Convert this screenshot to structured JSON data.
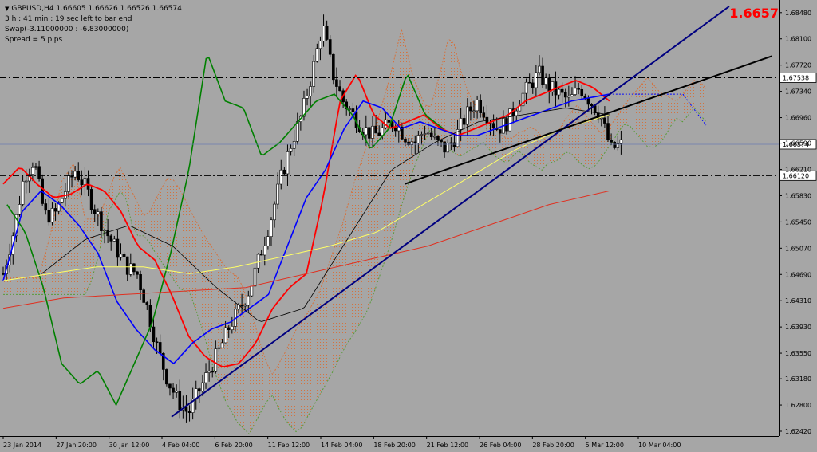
{
  "header": {
    "symbol_line": "GBPUSD,H4  1.66605 1.66626 1.66526 1.66574",
    "timer_line": "3 h : 41 min : 19 sec left to bar end",
    "swap_line": "Swap(-3.11000000 : -6.83000000)",
    "spread_line": "Spread = 5 pips",
    "current_price_big": "1.6657"
  },
  "colors": {
    "background": "#a6a6a6",
    "kijun": "#0000ff",
    "tenkan": "#ff0000",
    "chikou": "#008000",
    "ma_yellow": "#ffff66",
    "ma_red": "#e03020",
    "ma_black": "#000000",
    "trendline": "#000080",
    "cloud_up": "#d4733f",
    "cloud_down": "#5a9a3a"
  },
  "chart_data": {
    "type": "candlestick",
    "symbol": "GBPUSD",
    "timeframe": "H4",
    "ylim": [
      1.6242,
      1.6857
    ],
    "y_ticks": [
      "1.68480",
      "1.68100",
      "1.67720",
      "1.67340",
      "1.66960",
      "1.66590",
      "1.66210",
      "1.65830",
      "1.65450",
      "1.65070",
      "1.64690",
      "1.64310",
      "1.63930",
      "1.63550",
      "1.63180",
      "1.62800",
      "1.62420"
    ],
    "x_ticks": [
      "23 Jan 2014",
      "27 Jan 20:00",
      "30 Jan 12:00",
      "4 Feb 04:00",
      "6 Feb 20:00",
      "11 Feb 12:00",
      "14 Feb 04:00",
      "18 Feb 20:00",
      "21 Feb 12:00",
      "26 Feb 04:00",
      "28 Feb 20:00",
      "5 Mar 12:00",
      "10 Mar 04:00"
    ],
    "horizontal_levels": [
      {
        "price": 1.67538,
        "label": "1.67538",
        "style": "dash-dot"
      },
      {
        "price": 1.6612,
        "label": "1.66120",
        "style": "dash-dot"
      }
    ],
    "current_price": {
      "price": 1.66574,
      "label": "1.66574"
    },
    "close_path": [
      1.647,
      1.653,
      1.661,
      1.6635,
      1.6555,
      1.6555,
      1.659,
      1.662,
      1.6595,
      1.656,
      1.653,
      1.6505,
      1.648,
      1.647,
      1.642,
      1.636,
      1.6315,
      1.6285,
      1.6268,
      1.63,
      1.633,
      1.636,
      1.6395,
      1.642,
      1.645,
      1.65,
      1.655,
      1.661,
      1.666,
      1.67,
      1.676,
      1.683,
      1.676,
      1.672,
      1.67,
      1.668,
      1.667,
      1.668,
      1.669,
      1.667,
      1.666,
      1.668,
      1.666,
      1.665,
      1.667,
      1.67,
      1.672,
      1.67,
      1.668,
      1.669,
      1.672,
      1.674,
      1.676,
      1.674,
      1.673,
      1.672,
      1.674,
      1.672,
      1.67,
      1.665,
      1.6657
    ],
    "series": [
      {
        "name": "tenkan",
        "values": [
          1.66,
          1.6625,
          1.66,
          1.658,
          1.6585,
          1.66,
          1.659,
          1.656,
          1.651,
          1.649,
          1.644,
          1.638,
          1.635,
          1.6335,
          1.634,
          1.637,
          1.642,
          1.645,
          1.647,
          1.658,
          1.672,
          1.676,
          1.67,
          1.668,
          1.669,
          1.67,
          1.668,
          1.667,
          1.668,
          1.669,
          1.67,
          1.672,
          1.673,
          1.674,
          1.675,
          1.674,
          1.672
        ]
      },
      {
        "name": "kijun",
        "values": [
          1.646,
          1.656,
          1.659,
          1.657,
          1.654,
          1.65,
          1.643,
          1.639,
          1.636,
          1.634,
          1.637,
          1.639,
          1.64,
          1.642,
          1.644,
          1.651,
          1.658,
          1.662,
          1.668,
          1.672,
          1.671,
          1.668,
          1.669,
          1.668,
          1.667,
          1.667,
          1.668,
          1.669,
          1.67,
          1.671,
          1.672,
          1.6725,
          1.673
        ]
      },
      {
        "name": "chikou",
        "values": [
          1.657,
          1.653,
          1.645,
          1.634,
          1.631,
          1.633,
          1.628,
          1.634,
          1.64,
          1.65,
          1.662,
          1.679,
          1.672,
          1.671,
          1.664,
          1.666,
          1.669,
          1.672,
          1.673,
          1.67,
          1.665,
          1.668,
          1.676,
          1.67,
          1.668
        ]
      },
      {
        "name": "ma_yellow",
        "values": [
          1.646,
          1.647,
          1.648,
          1.648,
          1.647,
          1.648,
          1.6495,
          1.651,
          1.653,
          1.657,
          1.661,
          1.665,
          1.668,
          1.67
        ]
      },
      {
        "name": "ma_red",
        "values": [
          1.642,
          1.6435,
          1.644,
          1.6445,
          1.645,
          1.647,
          1.649,
          1.651,
          1.654,
          1.657,
          1.659
        ]
      },
      {
        "name": "ma_black",
        "values": [
          1.647,
          1.652,
          1.654,
          1.651,
          1.645,
          1.64,
          1.642,
          1.652,
          1.662,
          1.666,
          1.669,
          1.67,
          1.671,
          1.67
        ]
      }
    ],
    "trendlines": [
      {
        "name": "rising-blue",
        "from": [
          0.218,
          1.6263
        ],
        "to": [
          0.94,
          1.6857
        ]
      },
      {
        "name": "rising-black",
        "from": [
          0.52,
          1.66
        ],
        "to": [
          0.995,
          1.6785
        ]
      }
    ]
  }
}
